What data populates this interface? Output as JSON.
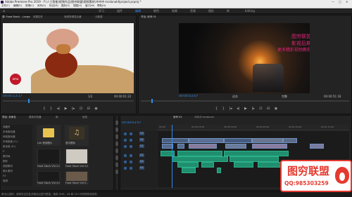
{
  "app": {
    "title": "Adobe Premiere Pro 2019 - F:\\人工智能\\视频作品\\图穷联盟\\视频素材\\冲冲冲 mcdonald\\project.prproj *",
    "icon": "premiere-icon"
  },
  "menu": [
    "文件(F)",
    "编辑(E)",
    "剪辑(C)",
    "序列(S)",
    "标记(M)",
    "图形(G)",
    "视图(V)",
    "窗口(W)",
    "帮助(H)"
  ],
  "workspaces": [
    "学习",
    "组件",
    "编辑",
    "颜色",
    "效果",
    "音频",
    "图形",
    "库",
    "Editing"
  ],
  "active_workspace": "编辑",
  "source": {
    "tabs": [
      "源: Food Stock – Lunge",
      "效果控件",
      "音频剪辑混合器",
      "元数据"
    ],
    "timecode": "00:00:13:17",
    "duration": "00:00:01:22",
    "fit": "1/2",
    "logo_text": "omo"
  },
  "program": {
    "tabs": [
      "节目: 序列 01"
    ],
    "timecode": "00:00:03:07",
    "fit": "适合",
    "full": "完整",
    "duration": "00:00:51:18",
    "overlay_lines": [
      "图穷联盟",
      "影视后期",
      "更多精彩视频教程"
    ]
  },
  "project": {
    "tabs": [
      "项目: 未命名",
      "媒体浏览器",
      "库",
      "信息"
    ],
    "sidebar": [
      "收藏夹",
      "本地驱动器",
      "网络驱动器",
      "本地磁盘 (C:)",
      "新加卷 (D:)",
      "F:",
      "素材库",
      "图形",
      "视频素材",
      "照片素材",
      "FX",
      "音频"
    ],
    "thumbs": [
      {
        "label": "Lab 音效图片"
      },
      {
        "label": "音乐图标"
      },
      {
        "label": "Food Stock Vid 2.m...",
        "dur": "1:07"
      },
      {
        "label": "Food Stock Vid 3.m...",
        "dur": "2:12"
      },
      {
        "label": "Food Stock Vid 4.m...",
        "dur": "1:19"
      },
      {
        "label": "Food Stock Vid 5...",
        "dur": "0:20"
      }
    ],
    "footer": "按住 Ctrl 键并拖动"
  },
  "timeline": {
    "tabs": [
      "序列 01",
      "冲冲冲 mcdonald"
    ],
    "timecode": "00:00:03:07",
    "ruler": [
      "00:00",
      "00:00:15:00",
      "00:00:30:00",
      "00:00:45:00",
      "00:01:00:00",
      "00:01:15:00"
    ],
    "tracks": [
      "V3",
      "V2",
      "V1",
      "A1",
      "A2",
      "A3"
    ]
  },
  "footer_left": "单击以选择，或单击空白处并拖动以进行框选。使用 Shift、Alt 和 Ctrl 可获得其他选项。",
  "watermark": {
    "title": "图穷联盟",
    "qq": "QQ:985303259",
    "flame_icon": "flame-icon"
  },
  "colors": {
    "accent": "#2d8ceb",
    "pink": "#e0247a",
    "watermark": "#e53a2f"
  }
}
